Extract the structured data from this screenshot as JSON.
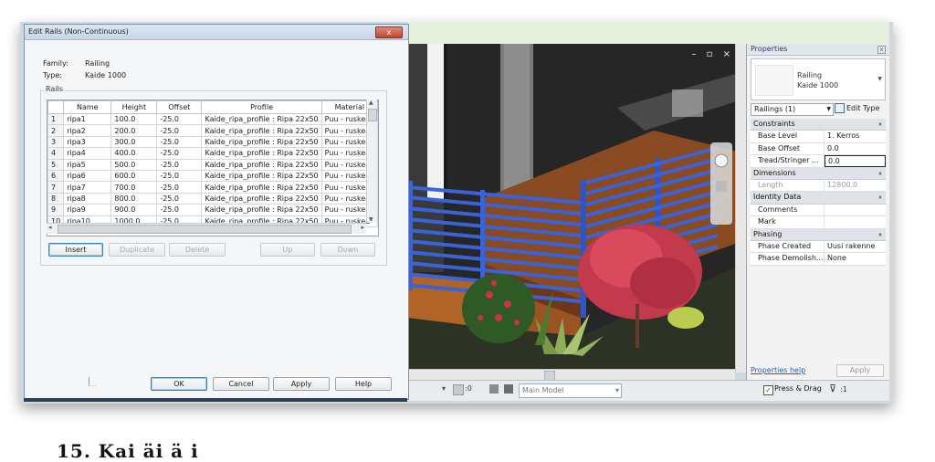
{
  "dialog": {
    "title": "Edit Rails (Non-Continuous)",
    "close": "x",
    "family_label": "Family:",
    "family_value": "Railing",
    "type_label": "Type:",
    "type_value": "Kaide 1000",
    "rails_group": "Rails",
    "columns": [
      "",
      "Name",
      "Height",
      "Offset",
      "Profile",
      "Material"
    ],
    "rows": [
      [
        "1",
        "ripa1",
        "100.0",
        "-25.0",
        "Kaide_ripa_profile : Ripa 22x50",
        "Puu - ruskea"
      ],
      [
        "2",
        "ripa2",
        "200.0",
        "-25.0",
        "Kaide_ripa_profile : Ripa 22x50",
        "Puu - ruskea"
      ],
      [
        "3",
        "ripa3",
        "300.0",
        "-25.0",
        "Kaide_ripa_profile : Ripa 22x50",
        "Puu - ruskea"
      ],
      [
        "4",
        "ripa4",
        "400.0",
        "-25.0",
        "Kaide_ripa_profile : Ripa 22x50",
        "Puu - ruskea"
      ],
      [
        "5",
        "ripa5",
        "500.0",
        "-25.0",
        "Kaide_ripa_profile : Ripa 22x50",
        "Puu - ruskea"
      ],
      [
        "6",
        "ripa6",
        "600.0",
        "-25.0",
        "Kaide_ripa_profile : Ripa 22x50",
        "Puu - ruskea"
      ],
      [
        "7",
        "ripa7",
        "700.0",
        "-25.0",
        "Kaide_ripa_profile : Ripa 22x50",
        "Puu - ruskea"
      ],
      [
        "8",
        "ripa8",
        "800.0",
        "-25.0",
        "Kaide_ripa_profile : Ripa 22x50",
        "Puu - ruskea"
      ],
      [
        "9",
        "ripa9",
        "900.0",
        "-25.0",
        "Kaide_ripa_profile : Ripa 22x50",
        "Puu - ruskea"
      ],
      [
        "10",
        "ripa10",
        "1000.0",
        "-25.0",
        "Kaide_ripa_profile : Ripa 22x50",
        "Puu - ruskea"
      ]
    ],
    "buttons": {
      "insert": "Insert",
      "duplicate": "Duplicate",
      "delete": "Delete",
      "up": "Up",
      "down": "Down",
      "ok": "OK",
      "cancel": "Cancel",
      "apply": "Apply",
      "help": "Help"
    }
  },
  "properties": {
    "title": "Properties",
    "type_name_line1": "Railing",
    "type_name_line2": "Kaide 1000",
    "instance_selector": "Railings (1)",
    "edit_type": "Edit Type",
    "groups": [
      {
        "name": "Constraints",
        "rows": [
          {
            "label": "Base Level",
            "value": "1. Kerros"
          },
          {
            "label": "Base Offset",
            "value": "0.0"
          },
          {
            "label": "Tread/Stringer ...",
            "value": "0.0"
          }
        ]
      },
      {
        "name": "Dimensions",
        "rows": [
          {
            "label": "Length",
            "value": "12800.0"
          }
        ]
      },
      {
        "name": "Identity Data",
        "rows": [
          {
            "label": "Comments",
            "value": ""
          },
          {
            "label": "Mark",
            "value": ""
          }
        ]
      },
      {
        "name": "Phasing",
        "rows": [
          {
            "label": "Phase Created",
            "value": "Uusi rakenne"
          },
          {
            "label": "Phase Demolish...",
            "value": "None"
          }
        ]
      }
    ],
    "help_link": "Properties help",
    "apply": "Apply"
  },
  "viewport": {
    "window_controls": "– ▫ ×"
  },
  "statusbar": {
    "zero": ":0",
    "model_select": "Main Model",
    "press_drag": "Press & Drag",
    "filter_count": ":1"
  },
  "caption": "15. Kai                          äi  ä  i",
  "colors": {
    "railing_blue": "#3a63d8",
    "deck_brown": "#8a4a22",
    "title_bar": "#c8d7e8"
  }
}
